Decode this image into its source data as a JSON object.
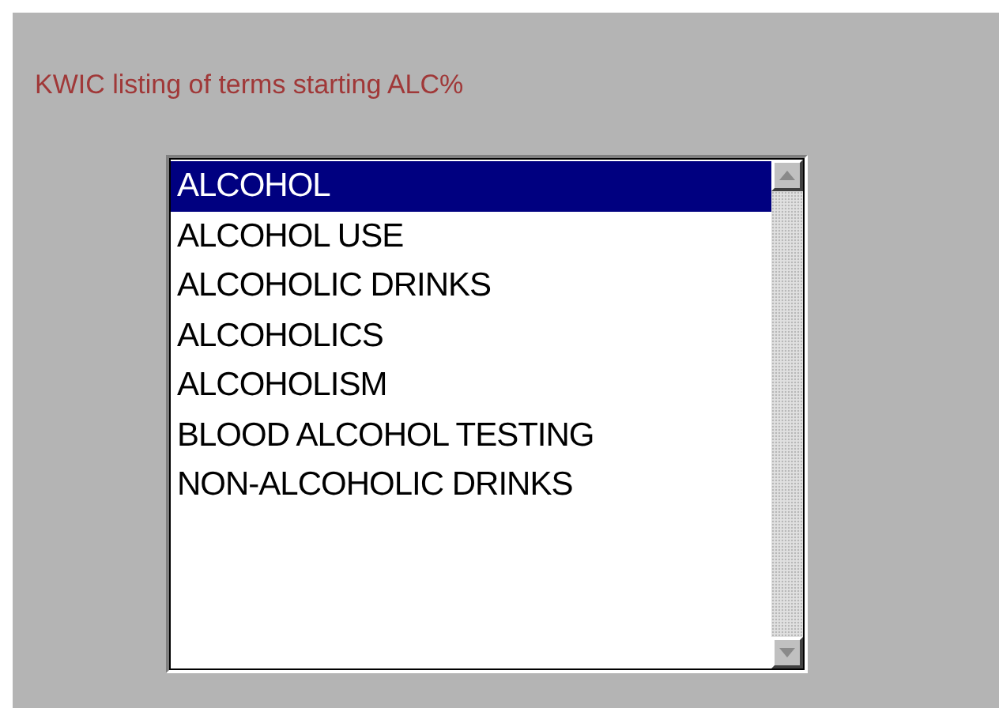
{
  "heading": "KWIC listing of terms starting ALC%",
  "list": {
    "items": [
      {
        "label": "ALCOHOL",
        "selected": true
      },
      {
        "label": "ALCOHOL USE",
        "selected": false
      },
      {
        "label": "ALCOHOLIC DRINKS",
        "selected": false
      },
      {
        "label": "ALCOHOLICS",
        "selected": false
      },
      {
        "label": "ALCOHOLISM",
        "selected": false
      },
      {
        "label": "BLOOD ALCOHOL TESTING",
        "selected": false
      },
      {
        "label": "NON-ALCOHOLIC DRINKS",
        "selected": false
      }
    ]
  }
}
